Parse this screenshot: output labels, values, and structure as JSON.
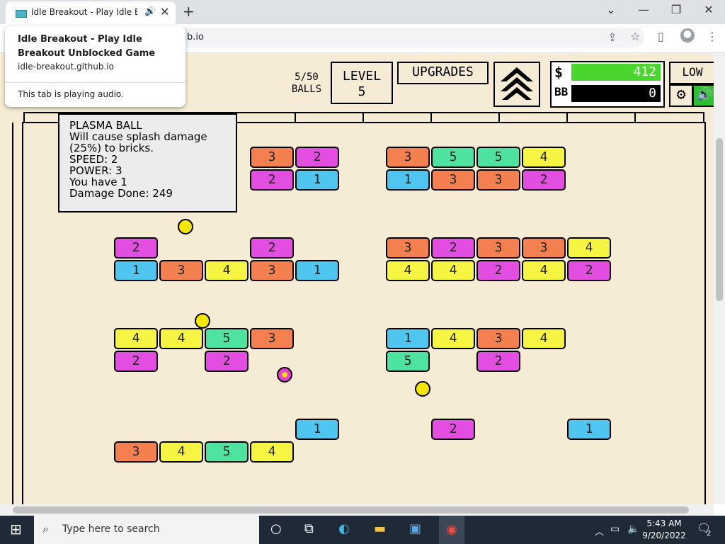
{
  "browser": {
    "tab_title": "Idle Breakout - Play Idle Breakout Unblocked Game",
    "tab_title_short": "Idle Breakout - Play Idle Brea",
    "address_partial": "b.io",
    "tooltip": {
      "title": "Idle Breakout - Play Idle Breakout Unblocked Game",
      "url": "idle-breakout.github.io",
      "audio_note": "This tab is playing audio."
    }
  },
  "hud": {
    "balls": "5/50",
    "balls_label": "BALLS",
    "level_label": "LEVEL",
    "level_value": "5",
    "upgrades_label": "UPGRADES",
    "money_symbol": "$",
    "money_value": "412",
    "bb_label": "BB",
    "bb_value": "0",
    "quality_label": "LOW"
  },
  "info": {
    "line1": "PLASMA BALL",
    "line2": "Will cause splash damage",
    "line3": "(25%) to bricks.",
    "line4": "SPEED: 2",
    "line5": "POWER: 3",
    "line6": "You have 1",
    "line7": "Damage Done: 249"
  },
  "bricks": [
    {
      "v": "3",
      "c": "#f47f4f"
    },
    {
      "v": "2",
      "c": "#e24fe0"
    },
    {
      "v": "2",
      "c": "#e24fe0"
    },
    {
      "v": "1",
      "c": "#4fc6ef"
    },
    {
      "v": "3",
      "c": "#f47f4f"
    },
    {
      "v": "5",
      "c": "#4fe3a0"
    },
    {
      "v": "5",
      "c": "#4fe3a0"
    },
    {
      "v": "4",
      "c": "#f5f542"
    },
    {
      "v": "1",
      "c": "#4fc6ef"
    },
    {
      "v": "3",
      "c": "#f47f4f"
    },
    {
      "v": "3",
      "c": "#f47f4f"
    },
    {
      "v": "2",
      "c": "#e24fe0"
    },
    {
      "v": "2",
      "c": "#e24fe0"
    },
    {
      "v": "2",
      "c": "#e24fe0"
    },
    {
      "v": "1",
      "c": "#4fc6ef"
    },
    {
      "v": "3",
      "c": "#f47f4f"
    },
    {
      "v": "4",
      "c": "#f5f542"
    },
    {
      "v": "3",
      "c": "#f47f4f"
    },
    {
      "v": "1",
      "c": "#4fc6ef"
    },
    {
      "v": "3",
      "c": "#f47f4f"
    },
    {
      "v": "2",
      "c": "#e24fe0"
    },
    {
      "v": "3",
      "c": "#f47f4f"
    },
    {
      "v": "3",
      "c": "#f47f4f"
    },
    {
      "v": "4",
      "c": "#f5f542"
    },
    {
      "v": "4",
      "c": "#f5f542"
    },
    {
      "v": "4",
      "c": "#f5f542"
    },
    {
      "v": "2",
      "c": "#e24fe0"
    },
    {
      "v": "4",
      "c": "#f5f542"
    },
    {
      "v": "2",
      "c": "#e24fe0"
    },
    {
      "v": "4",
      "c": "#f5f542"
    },
    {
      "v": "4",
      "c": "#f5f542"
    },
    {
      "v": "5",
      "c": "#4fe3a0"
    },
    {
      "v": "3",
      "c": "#f47f4f"
    },
    {
      "v": "2",
      "c": "#e24fe0"
    },
    {
      "v": "2",
      "c": "#e24fe0"
    },
    {
      "v": "1",
      "c": "#4fc6ef"
    },
    {
      "v": "4",
      "c": "#f5f542"
    },
    {
      "v": "3",
      "c": "#f47f4f"
    },
    {
      "v": "4",
      "c": "#f5f542"
    },
    {
      "v": "5",
      "c": "#4fe3a0"
    },
    {
      "v": "2",
      "c": "#e24fe0"
    },
    {
      "v": "1",
      "c": "#4fc6ef"
    },
    {
      "v": "2",
      "c": "#e24fe0"
    },
    {
      "v": "1",
      "c": "#4fc6ef"
    },
    {
      "v": "3",
      "c": "#f47f4f"
    },
    {
      "v": "4",
      "c": "#f5f542"
    },
    {
      "v": "5",
      "c": "#4fe3a0"
    },
    {
      "v": "4",
      "c": "#f5f542"
    }
  ],
  "taskbar": {
    "search_placeholder": "Type here to search",
    "time": "5:43 AM",
    "date": "9/20/2022",
    "notifications": "2"
  }
}
